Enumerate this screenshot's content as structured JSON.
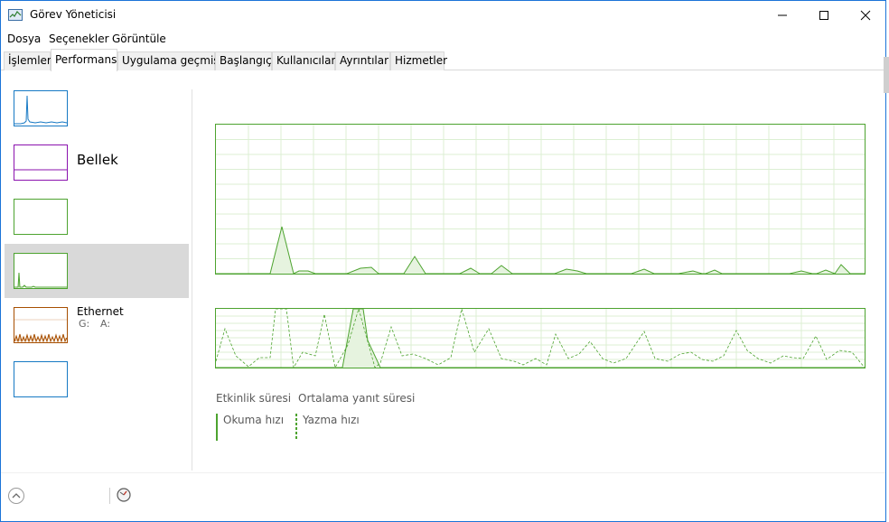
{
  "window": {
    "title": "Görev Yöneticisi",
    "accent_color": "#1b74d8"
  },
  "titlebar": {
    "minimize_icon": "minimize-icon",
    "maximize_icon": "maximize-icon",
    "close_icon": "close-icon"
  },
  "menu": {
    "items": [
      "Dosya",
      "Seçenekler",
      "Görüntüle"
    ]
  },
  "tabs": {
    "items": [
      "İşlemler",
      "Performans",
      "Uygulama geçmişi",
      "Başlangıç",
      "Kullanıcılar",
      "Ayrıntılar",
      "Hizmetler"
    ],
    "active": "Performans"
  },
  "sidebar": {
    "items": [
      {
        "title": "",
        "subtitle": "",
        "color": "#1779c4"
      },
      {
        "title": "Bellek",
        "subtitle": "",
        "color": "#8b12ae"
      },
      {
        "title": "",
        "subtitle": "",
        "color": "#4da32f"
      },
      {
        "title": "",
        "subtitle": "",
        "color": "#4da32f"
      },
      {
        "title": "Ethernet",
        "subtitle_left": "G:",
        "subtitle_right": "A:",
        "color": "#a74f01"
      },
      {
        "title": "",
        "subtitle": "",
        "color": "#1779c4"
      }
    ]
  },
  "main": {
    "legend": {
      "active_time": "Etkinlik süresi",
      "avg_response": "Ortalama yanıt süresi",
      "read_speed": "Okuma hızı",
      "write_speed": "Yazma hızı"
    },
    "graph_color": "#4da32f"
  },
  "footer": {
    "collapse_icon": "chevron-up-icon",
    "monitor_icon": "resource-monitor-icon"
  }
}
